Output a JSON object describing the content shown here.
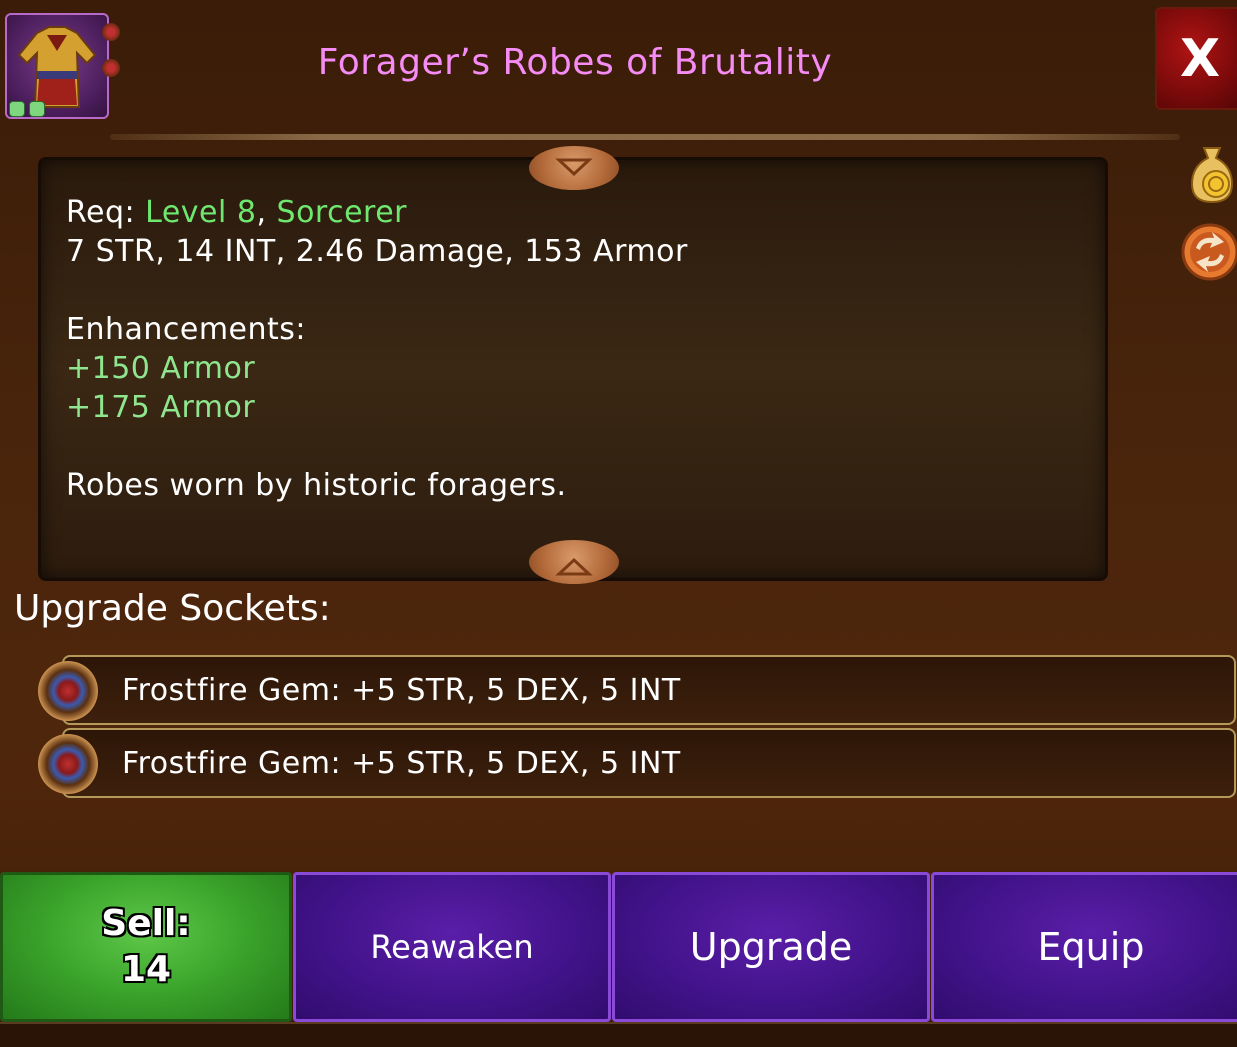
{
  "item": {
    "title": "Forager’s Robes of Brutality",
    "icon": "robe-icon"
  },
  "close_label": "X",
  "description": {
    "req_label": "Req: ",
    "req_level": "Level 8",
    "req_sep": ", ",
    "req_class": "Sorcerer",
    "stats": "7 STR, 14 INT, 2.46 Damage, 153 Armor",
    "enhancements_label": "Enhancements:",
    "enhancements": [
      "+150 Armor",
      "+175 Armor"
    ],
    "flavor": "Robes worn by historic foragers."
  },
  "sockets": {
    "label": "Upgrade Sockets:",
    "items": [
      {
        "text": "Frostfire Gem: +5 STR, 5 DEX, 5 INT",
        "icon": "frostfire-gem-icon"
      },
      {
        "text": "Frostfire Gem: +5 STR, 5 DEX, 5 INT",
        "icon": "frostfire-gem-icon"
      }
    ]
  },
  "buttons": {
    "sell_label": "Sell:",
    "sell_value": "14",
    "reawaken": "Reawaken",
    "upgrade": "Upgrade",
    "equip": "Equip"
  },
  "side_icons": [
    "gold-bag-icon",
    "swap-icon"
  ],
  "colors": {
    "title": "#f58cf5",
    "requirement": "#6fe86f",
    "enhancement": "#8fe68f",
    "sell_button": "#3aa32a",
    "action_button": "#401288",
    "close_button": "#7a0a0a"
  }
}
